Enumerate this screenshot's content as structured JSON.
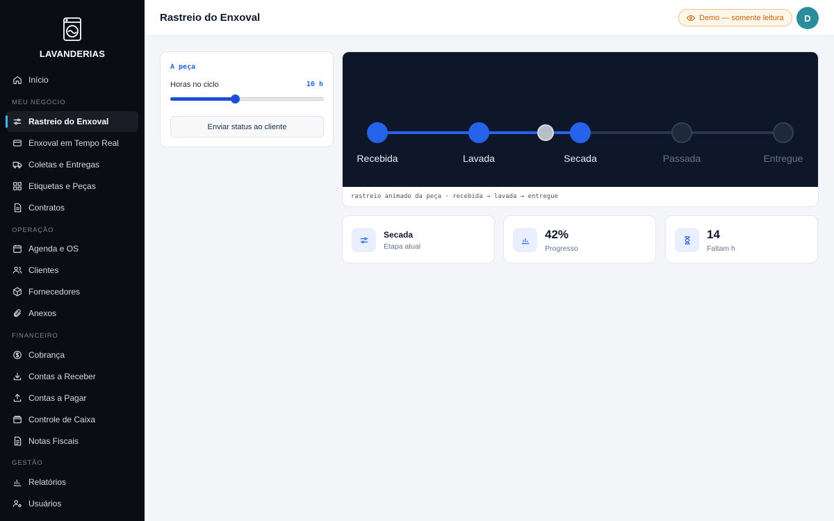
{
  "brand": {
    "name": "LAVANDERIAS",
    "icon": "washing-machine-icon"
  },
  "sidebar": {
    "home": {
      "label": "Início",
      "icon": "home-icon"
    },
    "sections": [
      {
        "title": "MEU NEGÓCIO",
        "items": [
          {
            "label": "Rastreio do Enxoval",
            "icon": "sliders-icon",
            "active": true
          },
          {
            "label": "Enxoval em Tempo Real",
            "icon": "card-icon"
          },
          {
            "label": "Coletas e Entregas",
            "icon": "truck-icon"
          },
          {
            "label": "Etiquetas e Peças",
            "icon": "grid-icon"
          },
          {
            "label": "Contratos",
            "icon": "document-icon"
          }
        ]
      },
      {
        "title": "OPERAÇÃO",
        "items": [
          {
            "label": "Agenda e OS",
            "icon": "calendar-icon"
          },
          {
            "label": "Clientes",
            "icon": "users-icon"
          },
          {
            "label": "Fornecedores",
            "icon": "box-icon"
          },
          {
            "label": "Anexos",
            "icon": "paperclip-icon"
          }
        ]
      },
      {
        "title": "FINANCEIRO",
        "items": [
          {
            "label": "Cobrança",
            "icon": "dollar-icon"
          },
          {
            "label": "Contas a Receber",
            "icon": "download-icon"
          },
          {
            "label": "Contas a Pagar",
            "icon": "upload-icon"
          },
          {
            "label": "Controle de Caixa",
            "icon": "wallet-icon"
          },
          {
            "label": "Notas Fiscais",
            "icon": "receipt-icon"
          }
        ]
      },
      {
        "title": "GESTÃO",
        "items": [
          {
            "label": "Relatórios",
            "icon": "bar-chart-icon"
          },
          {
            "label": "Usuários",
            "icon": "user-gear-icon"
          }
        ]
      }
    ]
  },
  "header": {
    "title": "Rastreio do Enxoval",
    "badge": "Demo — somente leitura",
    "avatar_initial": "D"
  },
  "controls": {
    "card_title": "A peça",
    "hours_label": "Horas no ciclo",
    "hours_value": "10 h",
    "slider_fraction": 0.42,
    "send_button": "Enviar status ao cliente"
  },
  "tracker": {
    "stages": [
      "Recebida",
      "Lavada",
      "Secada",
      "Passada",
      "Entregue"
    ],
    "completed_stages": 3,
    "progress_fraction": 0.42,
    "caption": "rastreio animado da peça · recebida → lavada → entregue"
  },
  "stats": [
    {
      "value": "Secada",
      "label": "Etapa atual",
      "icon": "sliders-icon"
    },
    {
      "value": "42%",
      "label": "Progresso",
      "icon": "bar-chart-icon"
    },
    {
      "value": "14",
      "label": "Faltam h",
      "icon": "hourglass-icon"
    }
  ],
  "colors": {
    "sidebar_bg": "#0c0d14",
    "accent": "#2563eb",
    "tracker_bg": "#0e1629",
    "badge_text": "#c2620d",
    "avatar_bg": "#2a8d9c"
  }
}
